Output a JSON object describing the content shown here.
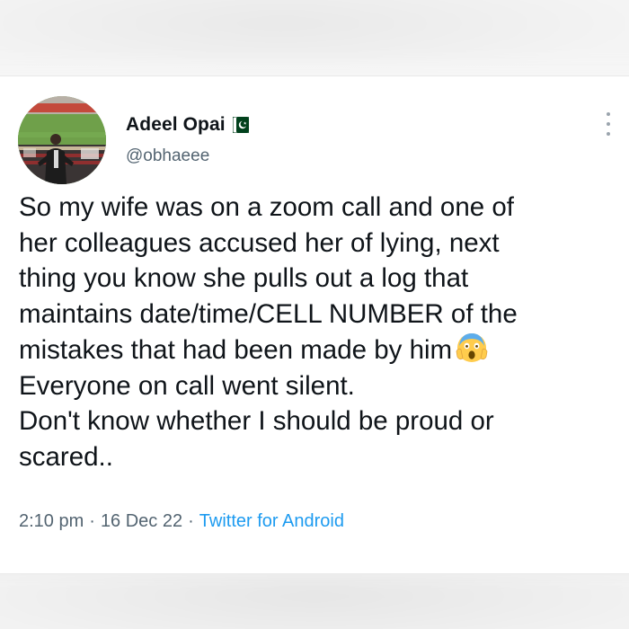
{
  "user": {
    "display_name": "Adeel Opai",
    "handle": "@obhaeee",
    "flag_icon": "pakistan-flag-icon",
    "avatar_icon": "profile-photo-stadium"
  },
  "tweet": {
    "lines": [
      "So my wife was on a zoom call and one of",
      "her colleagues accused her of lying, next",
      "thing you know she pulls out a log that",
      "maintains date/time/CELL NUMBER of the",
      "mistakes that had been made by him",
      "Everyone on call went silent.",
      "Don't know whether I should be proud or",
      "scared.."
    ],
    "emoji_icon": "face-screaming-in-fear-icon"
  },
  "meta": {
    "time": "2:10 pm",
    "separator": "·",
    "date": "16 Dec 22",
    "source": "Twitter for Android"
  },
  "colors": {
    "primary_text": "#0f1419",
    "secondary_text": "#536471",
    "link": "#1d9bf0",
    "flag_green": "#01411c"
  }
}
